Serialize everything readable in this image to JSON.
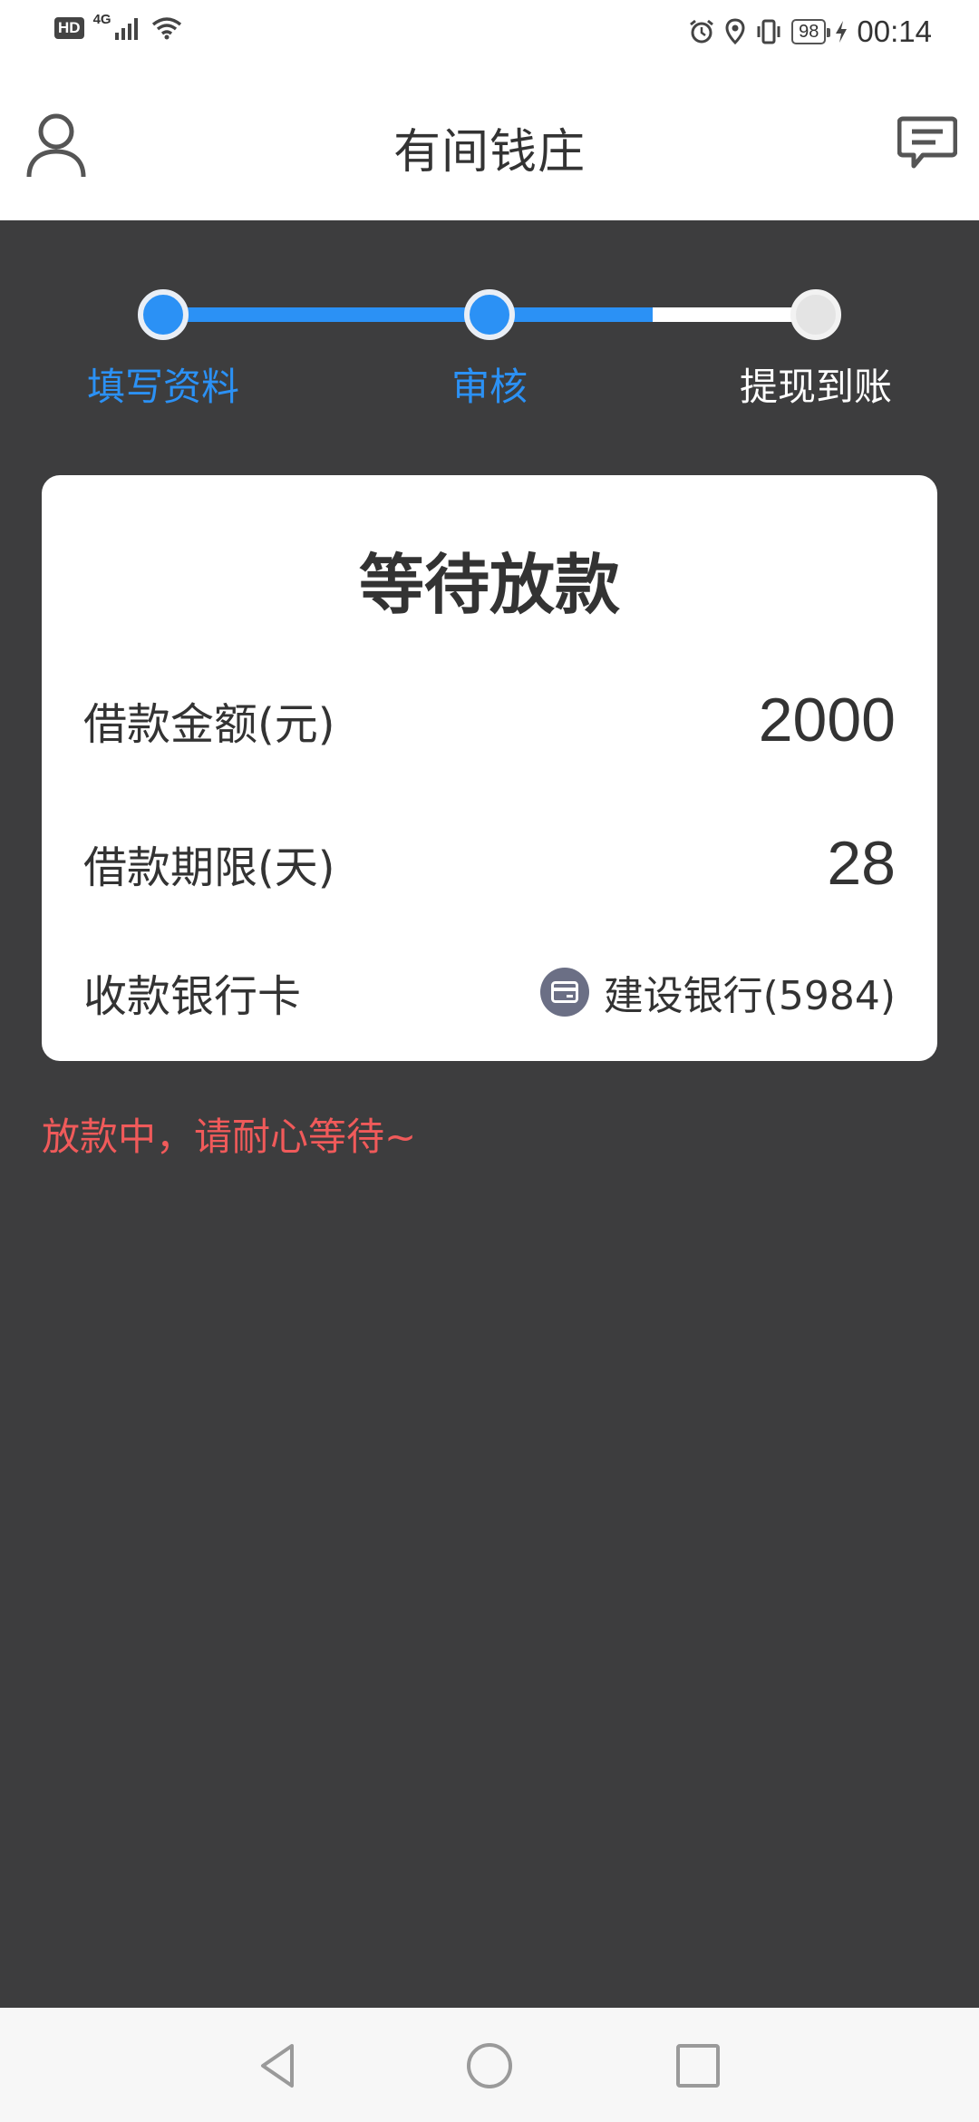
{
  "status_bar": {
    "hd": "HD",
    "network": "4G",
    "battery": "98",
    "time": "00:14"
  },
  "header": {
    "title": "有间钱庄",
    "left_icon": "user-icon",
    "right_icon": "message-icon"
  },
  "steps": [
    {
      "label": "填写资料",
      "state": "done"
    },
    {
      "label": "审核",
      "state": "done"
    },
    {
      "label": "提现到账",
      "state": "pending"
    }
  ],
  "card": {
    "title": "等待放款",
    "amount_label": "借款金额(元)",
    "amount_value": "2000",
    "term_label": "借款期限(天)",
    "term_value": "28",
    "bank_label": "收款银行卡",
    "bank_value": "建设银行(5984)",
    "bank_icon": "card-icon"
  },
  "notice": "放款中，请耐心等待~",
  "colors": {
    "accent": "#2b91f5",
    "background": "#3d3d3e",
    "notice": "#f05a5a"
  },
  "nav": {
    "back_icon": "back-triangle-icon",
    "home_icon": "home-circle-icon",
    "recent_icon": "recents-square-icon"
  }
}
